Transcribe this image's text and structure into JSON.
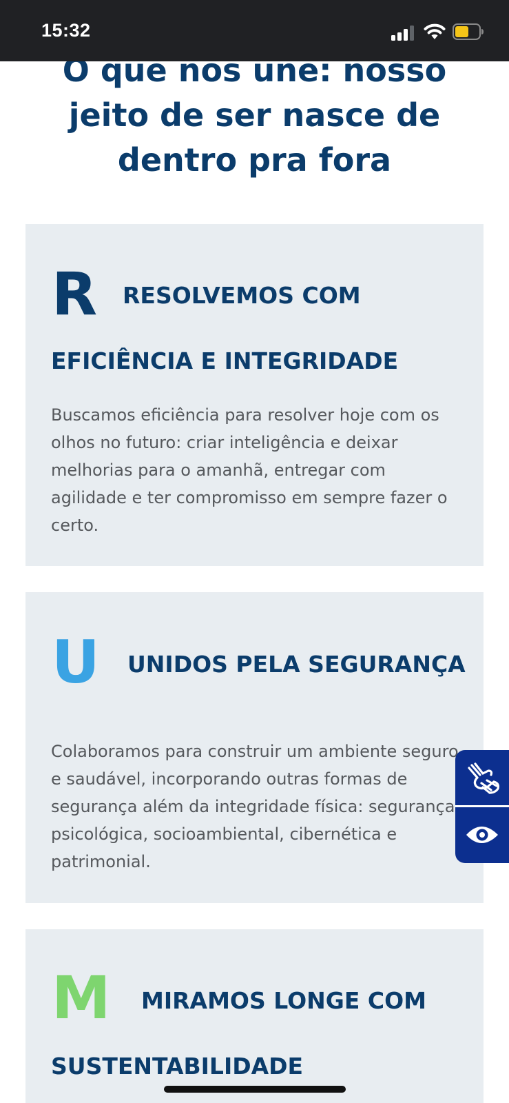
{
  "status_bar": {
    "time": "15:32"
  },
  "heading": {
    "line1": "O que nos une: nosso",
    "line2": "jeito de ser nasce de",
    "line3": "dentro pra fora"
  },
  "cards": [
    {
      "letter": "R",
      "letter_color": "#0b3c6b",
      "title_line1": "RESOLVEMOS COM",
      "title_line2": "EFICIÊNCIA E INTEGRIDADE",
      "body": "Buscamos eficiência para resolver hoje com os olhos no futuro: criar inteligência e deixar melhorias para o amanhã, entregar com agilidade e ter compromisso em sempre fazer o certo."
    },
    {
      "letter": "U",
      "letter_color": "#3aa3e3",
      "title_line1": "UNIDOS PELA SEGURANÇA",
      "body": "Colaboramos para construir um ambiente seguro e saudável, incorporando outras formas de segurança além da integridade física: segurança psicológica, socioambiental, cibernética e patrimonial."
    },
    {
      "letter": "M",
      "letter_color": "#7ed56f",
      "title_line1": "MIRAMOS LONGE COM",
      "title_line2": "SUSTENTABILIDADE"
    }
  ],
  "accessibility": {
    "sign_language_icon": "sign-language-icon",
    "visual_icon": "eye-icon",
    "color": "#0c2f8f"
  },
  "colors": {
    "heading": "#0b3c6b",
    "card_background": "#e8edf1",
    "body_text": "#55585c"
  }
}
